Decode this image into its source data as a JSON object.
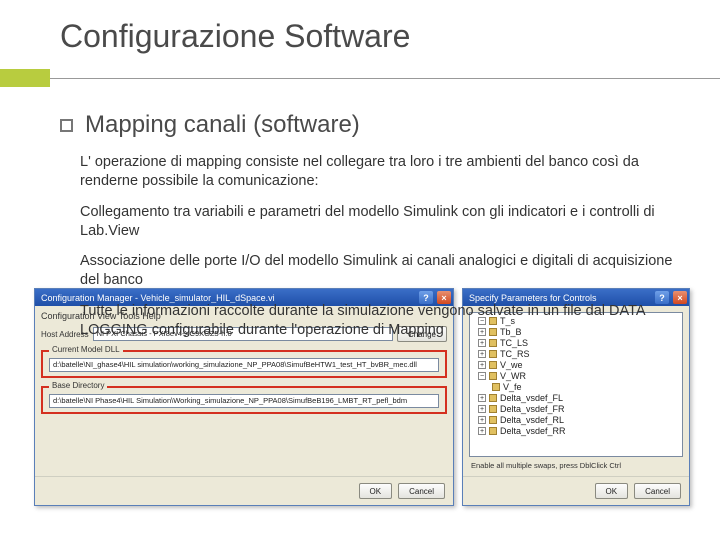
{
  "title": "Configurazione Software",
  "subtitle": "Mapping canali (software)",
  "paragraphs": {
    "p1": "L' operazione di mapping consiste nel collegare tra loro i tre ambienti del banco così da renderne possibile la comunicazione:",
    "p2": "Collegamento tra variabili e parametri del modello Simulink con gli indicatori e i controlli di Lab.View",
    "p3": "Associazione delle porte I/O del modello Simulink ai canali analogici e digitali di acquisizione del banco",
    "p4": "Tutte le informazioni raccolte durante la simulazione vengono salvate in un file dal DATA LOGGING configurabile durante l'operazione di Mapping"
  },
  "dialogLeft": {
    "title": "Configuration Manager - Vehicle_simulator_HIL_dSpace.vi",
    "menu": "Configuration View Tools Help",
    "hostAddrLabel": "Host Address",
    "hostAddrValue": "NI PXI Chassis - PXI8ev4-XC9XGZ5-h:0",
    "changeBtn": "Change",
    "modelGroupLabel": "Current Model DLL",
    "modelDllValue": "d:\\batelle\\NI_ghase4\\HIL simulation\\working_simulazione_NP_PPA08\\SimufBeHTW1_test_HT_bvBR_mec.dll",
    "dirGroupLabel": "Base Directory",
    "baseDirValue": "d:\\batelle\\NI Phase4\\HIL Simulation\\Working_simulazione_NP_PPA08\\SimufBeB196_LMBT_RT_pefl_bdm",
    "okBtn": "OK",
    "cancelBtn": "Cancel"
  },
  "dialogRight": {
    "title": "Specify Parameters for Controls",
    "items": [
      "T_s",
      "Tb_B",
      "TC_LS",
      "TC_RS",
      "V_we",
      "V_WR",
      "V_fe",
      "Delta_vsdef_FL",
      "Delta_vsdef_FR",
      "Delta_vsdef_RL",
      "Delta_vsdef_RR"
    ],
    "footerCaption": "Enable all multiple swaps, press DblClick Ctrl",
    "okBtn": "OK",
    "cancelBtn": "Cancel"
  }
}
